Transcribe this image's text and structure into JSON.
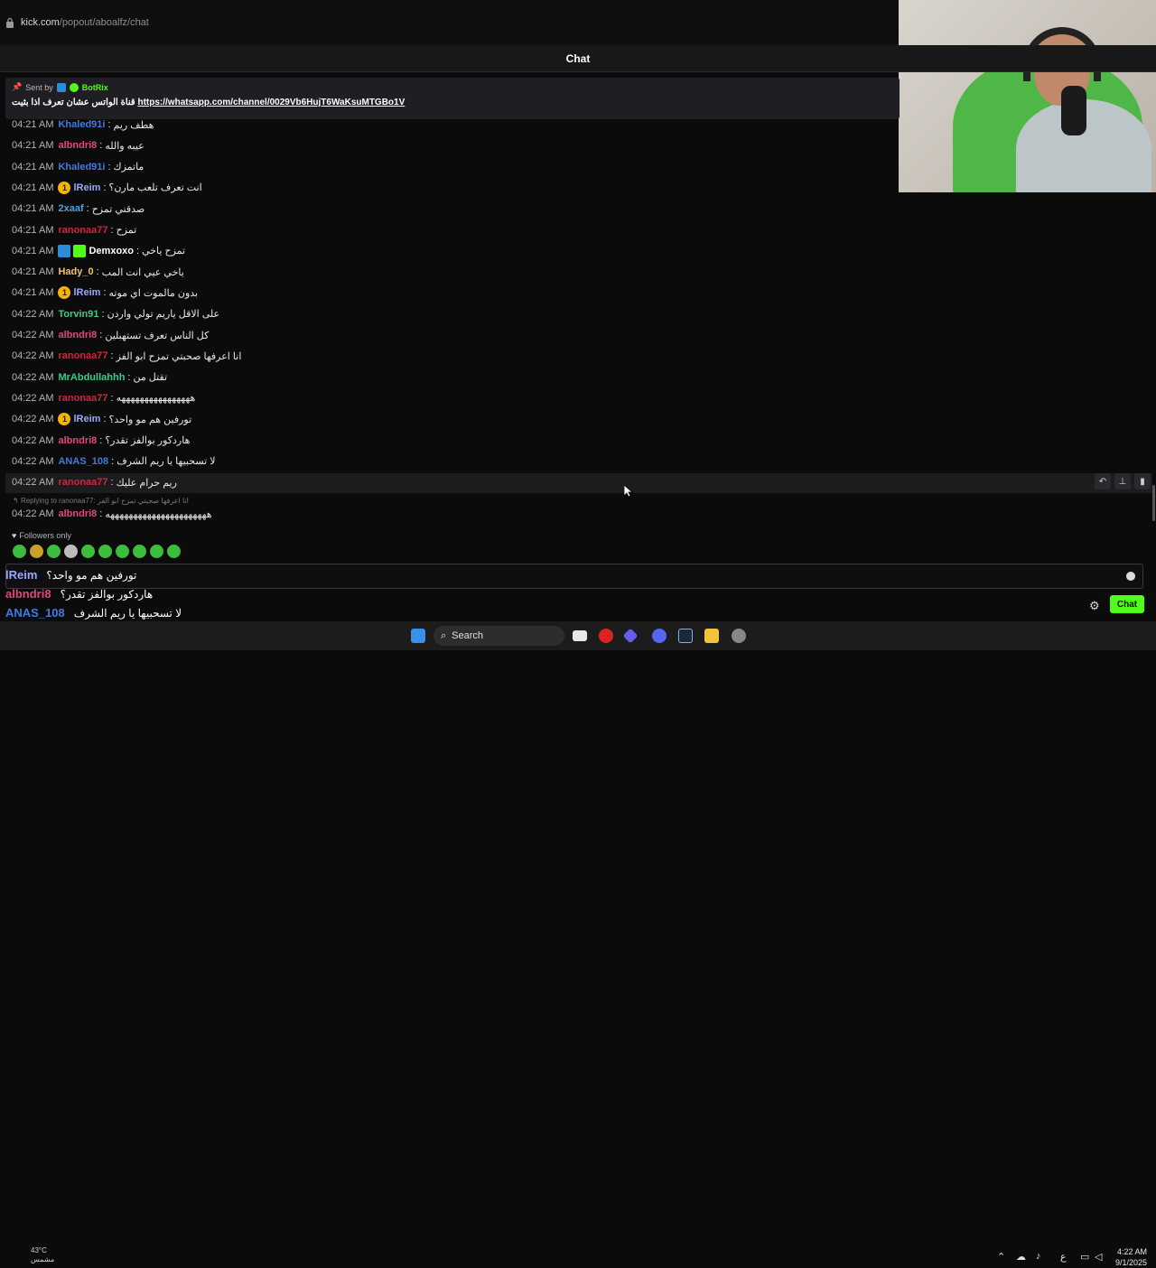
{
  "browser": {
    "url_host": "kick.com",
    "url_path": "/popout/aboalfz/chat"
  },
  "header": {
    "title": "Chat"
  },
  "pinned": {
    "sent_by_label": "Sent by",
    "bot_name": "BotRix",
    "message_prefix": "قناة الواتس عشان تعرف اذا بثيت",
    "link": "https://whatsapp.com/channel/0029Vb6HujT6WaKsuMTGBo1V"
  },
  "messages": [
    {
      "time": "04:21 AM",
      "user": "Khaled91i",
      "color": "#3f7be0",
      "text": "هطف ريم",
      "badges": []
    },
    {
      "time": "04:21 AM",
      "user": "albndri8",
      "color": "#e0467f",
      "text": "عيبه والله",
      "badges": []
    },
    {
      "time": "04:21 AM",
      "user": "Khaled91i",
      "color": "#3f7be0",
      "text": "ماتمزك",
      "badges": []
    },
    {
      "time": "04:21 AM",
      "user": "lReim",
      "color": "#9aa7ff",
      "text": "انت تعرف تلعب مارن؟",
      "badges": [
        "gold"
      ]
    },
    {
      "time": "04:21 AM",
      "user": "2xaaf",
      "color": "#4aa3e0",
      "text": "صدقني تمزح",
      "badges": []
    },
    {
      "time": "04:21 AM",
      "user": "ranonaa77",
      "color": "#d2243d",
      "text": "تمزح",
      "badges": []
    },
    {
      "time": "04:21 AM",
      "user": "Demxoxo",
      "color": "#ffffff",
      "text": "تمزح ياخي",
      "badges": [
        "blue",
        "green"
      ]
    },
    {
      "time": "04:21 AM",
      "user": "Hady_0",
      "color": "#f6c26b",
      "text": "ياخي عيي انت المب",
      "badges": []
    },
    {
      "time": "04:21 AM",
      "user": "lReim",
      "color": "#9aa7ff",
      "text": "بدون مالموت اي موته",
      "badges": [
        "gold"
      ]
    },
    {
      "time": "04:22 AM",
      "user": "Torvin91",
      "color": "#3fc98a",
      "text": "على الاقل ياريم تولي واردن",
      "badges": []
    },
    {
      "time": "04:22 AM",
      "user": "albndri8",
      "color": "#e0467f",
      "text": "كل الناس تعرف تستهبلين",
      "badges": []
    },
    {
      "time": "04:22 AM",
      "user": "ranonaa77",
      "color": "#d2243d",
      "text": "انا اعرفها صحبتي تمزح ابو الفز",
      "badges": []
    },
    {
      "time": "04:22 AM",
      "user": "MrAbdullahhh",
      "color": "#3fc98a",
      "text": "تقتل من",
      "badges": []
    },
    {
      "time": "04:22 AM",
      "user": "ranonaa77",
      "color": "#d2243d",
      "text": "ههههههههههههههههه",
      "badges": []
    },
    {
      "time": "04:22 AM",
      "user": "lReim",
      "color": "#9aa7ff",
      "text": "تورفين هم مو واحد؟",
      "badges": [
        "gold"
      ]
    },
    {
      "time": "04:22 AM",
      "user": "albndri8",
      "color": "#e0467f",
      "text": "هاردكور بوالفز تقدر؟",
      "badges": []
    },
    {
      "time": "04:22 AM",
      "user": "ANAS_108",
      "color": "#3f7be0",
      "text": "لا تسحبيها يا ريم الشرف",
      "badges": []
    },
    {
      "time": "04:22 AM",
      "user": "ranonaa77",
      "color": "#d2243d",
      "text": "ريم حرام عليك",
      "badges": []
    }
  ],
  "reply": {
    "label": "Replying to ranonaa77:",
    "quoted": "انا اعرفها صحبتي تمزح ابو الفز",
    "time": "04:22 AM",
    "user": "albndri8",
    "color": "#e0467f",
    "text": "ههههههههههههههههههههههه"
  },
  "followers_only": "Followers only",
  "send_button": "Chat",
  "overlay_messages": [
    {
      "user": "lReim",
      "color": "#9aa7ff",
      "text": "تورفين هم مو واحد؟"
    },
    {
      "user": "albndri8",
      "color": "#e0467f",
      "text": "هاردكور بوالفز تقدر؟"
    },
    {
      "user": "ANAS_108",
      "color": "#3f7be0",
      "text": "لا تسحبيها يا ريم الشرف"
    },
    {
      "user": "ranonaa77",
      "color": "#d2243d",
      "text": "ريم حرام عليك"
    }
  ],
  "taskbar": {
    "search_label": "Search",
    "weather_temp": "43°C",
    "weather_desc": "مشمس",
    "lang": "ع",
    "time": "4:22 AM",
    "date": "9/1/2025"
  },
  "accent_color": "#53fc18"
}
